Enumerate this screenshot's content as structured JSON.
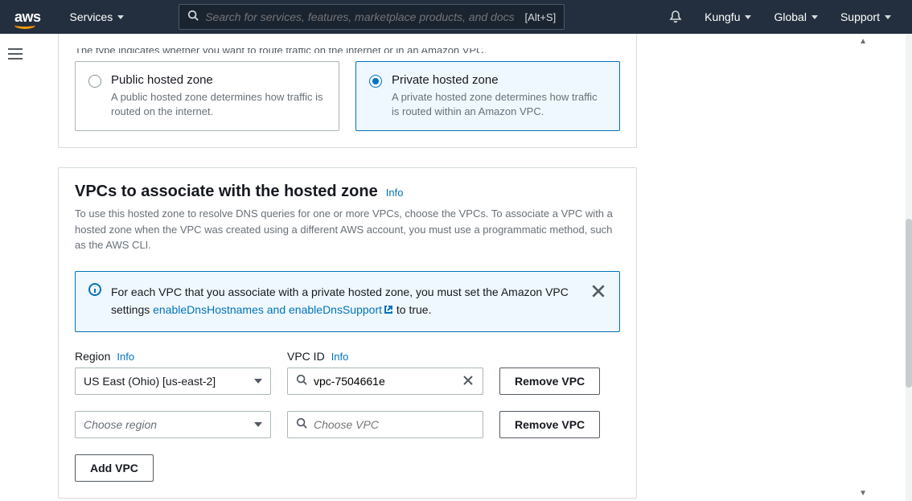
{
  "nav": {
    "logo_text": "aws",
    "services": "Services",
    "search_placeholder": "Search for services, features, marketplace products, and docs",
    "search_shortcut": "[Alt+S]",
    "user": "Kungfu",
    "region": "Global",
    "support": "Support"
  },
  "zone_type": {
    "cutoff_text": "The type indicates whether you want to route traffic on the internet or in an Amazon VPC.",
    "public": {
      "title": "Public hosted zone",
      "desc": "A public hosted zone determines how traffic is routed on the internet."
    },
    "private": {
      "title": "Private hosted zone",
      "desc": "A private hosted zone determines how traffic is routed within an Amazon VPC."
    }
  },
  "vpc_section": {
    "heading": "VPCs to associate with the hosted zone",
    "info_label": "Info",
    "helptext": "To use this hosted zone to resolve DNS queries for one or more VPCs, choose the VPCs. To associate a VPC with a hosted zone when the VPC was created using a different AWS account, you must use a programmatic method, such as the AWS CLI.",
    "flash": {
      "pre": "For each VPC that you associate with a private hosted zone, you must set the Amazon VPC settings ",
      "link": "enableDnsHostnames and enableDnsSupport",
      "post": " to true."
    },
    "labels": {
      "region": "Region",
      "vpc_id": "VPC ID",
      "remove": "Remove VPC",
      "region_placeholder": "Choose region",
      "vpc_placeholder": "Choose VPC",
      "add": "Add VPC"
    },
    "rows": [
      {
        "region": "US East (Ohio) [us-east-2]",
        "vpc": "vpc-7504661e",
        "has_value": true
      },
      {
        "region": "",
        "vpc": "",
        "has_value": false
      }
    ]
  }
}
